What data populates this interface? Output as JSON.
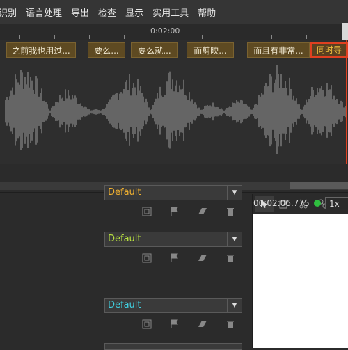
{
  "menu": [
    "识别",
    "语言处理",
    "导出",
    "检查",
    "显示",
    "实用工具",
    "帮助"
  ],
  "ruler": {
    "time": "0:02:00"
  },
  "subtitles": [
    {
      "text": "之前我也用过..."
    },
    {
      "text": "要么..."
    },
    {
      "text": "要么就..."
    },
    {
      "text": "而剪映..."
    },
    {
      "text": "而且有非常..."
    },
    {
      "text": "同时导",
      "active": true
    }
  ],
  "styles": [
    {
      "label": "Default",
      "color": "#f0b030"
    },
    {
      "label": "Default",
      "color": "#b8e040"
    },
    {
      "label": "Default",
      "color": "#40d0e0"
    }
  ],
  "player": {
    "timecode": "00:02:06.775",
    "speed": "1x",
    "status_color": "#2fbf3f"
  },
  "icons": {
    "style_row": [
      "frame-icon",
      "flag-icon",
      "eraser-icon",
      "trash-icon"
    ],
    "toolbar": [
      "pointer-icon",
      "edit-icon",
      "scissors-icon",
      "link-icon"
    ]
  },
  "colors": {
    "accent": "#4a90d9",
    "subtitle_bg": "#5e4a22",
    "active_border": "#e04020"
  }
}
